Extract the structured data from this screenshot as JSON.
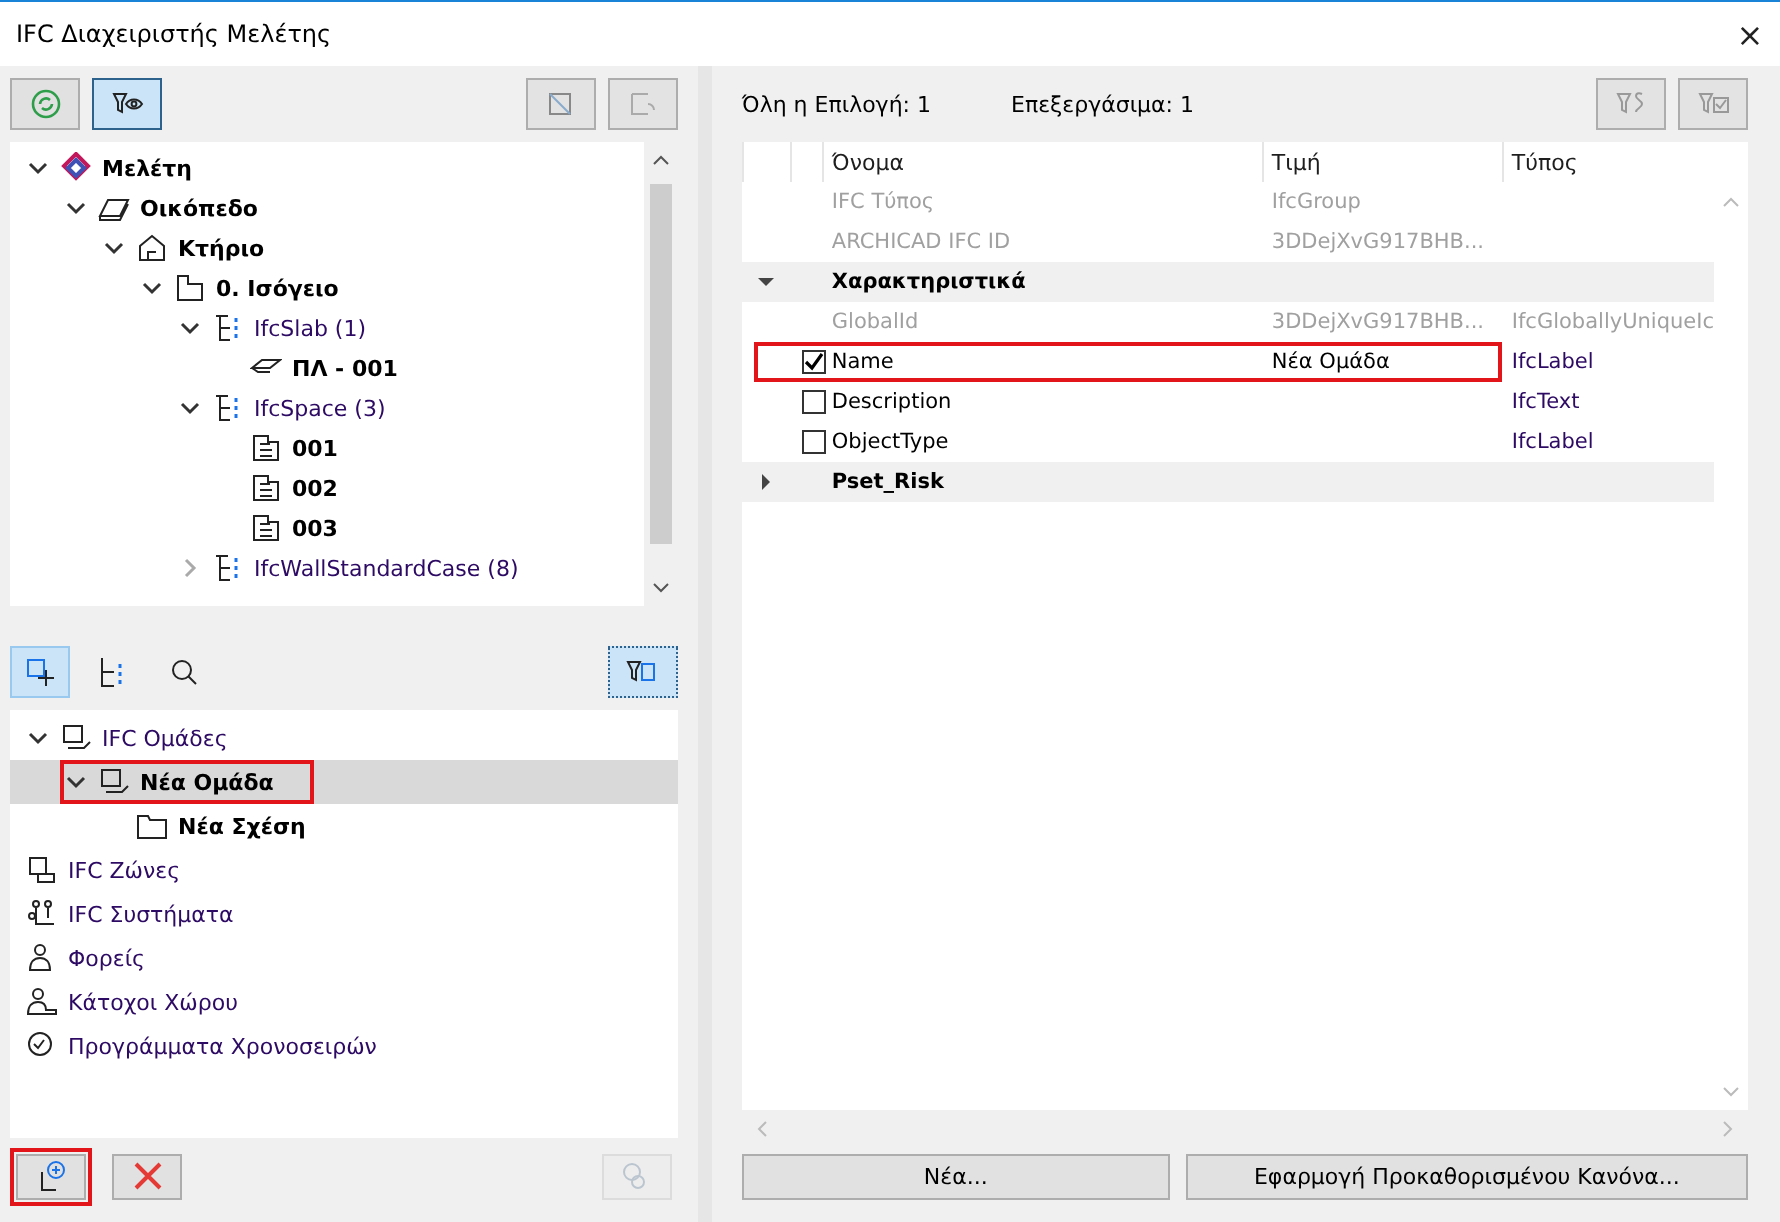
{
  "window": {
    "title": "IFC Διαχειριστής Μελέτης",
    "close": "×"
  },
  "project_toolbar": {
    "filter_view_on": true
  },
  "project_tree": [
    {
      "label": "Μελέτη",
      "kind": "project",
      "bold": true,
      "expanded": true,
      "children": [
        {
          "label": "Οικόπεδο",
          "kind": "site",
          "bold": true,
          "expanded": true,
          "children": [
            {
              "label": "Κτήριο",
              "kind": "building",
              "bold": true,
              "expanded": true,
              "children": [
                {
                  "label": "0. Ισόγειο",
                  "kind": "storey",
                  "bold": true,
                  "expanded": true,
                  "children": [
                    {
                      "label": "IfcSlab (1)",
                      "kind": "class",
                      "bold": false,
                      "expanded": true,
                      "children": [
                        {
                          "label": "ΠΛ - 001",
                          "kind": "slab",
                          "bold": true
                        }
                      ]
                    },
                    {
                      "label": "IfcSpace (3)",
                      "kind": "class",
                      "bold": false,
                      "expanded": true,
                      "children": [
                        {
                          "label": "001",
                          "kind": "space",
                          "bold": true
                        },
                        {
                          "label": "002",
                          "kind": "space",
                          "bold": true
                        },
                        {
                          "label": "003",
                          "kind": "space",
                          "bold": true
                        }
                      ]
                    },
                    {
                      "label": "IfcWallStandardCase (8)",
                      "kind": "class",
                      "bold": false,
                      "expanded": false
                    }
                  ]
                }
              ]
            }
          ]
        }
      ]
    }
  ],
  "group_toolbar": [
    {
      "kind": "groups",
      "selected": true
    },
    {
      "kind": "tree",
      "selected": false
    },
    {
      "kind": "search",
      "selected": false
    }
  ],
  "group_tree": [
    {
      "label": "IFC Ομάδες",
      "kind": "group",
      "bold": false,
      "expanded": true,
      "selected": false,
      "highlighted": false,
      "children": [
        {
          "label": "Νέα Ομάδα",
          "kind": "group",
          "bold": true,
          "expanded": true,
          "selected": true,
          "highlighted": true,
          "children": [
            {
              "label": "Νέα Σχέση",
              "kind": "folder",
              "bold": true,
              "selected": false,
              "highlighted": false
            }
          ]
        }
      ]
    },
    {
      "label": "IFC Ζώνες",
      "kind": "zone",
      "bold": false,
      "selected": false,
      "highlighted": false
    },
    {
      "label": "IFC Συστήματα",
      "kind": "system",
      "bold": false,
      "selected": false,
      "highlighted": false
    },
    {
      "label": "Φορείς",
      "kind": "actor",
      "bold": false,
      "selected": false,
      "highlighted": false
    },
    {
      "label": "Κάτοχοι Χώρου",
      "kind": "occupant",
      "bold": false,
      "selected": false,
      "highlighted": false
    },
    {
      "label": "Προγράμματα Χρονοσειρών",
      "kind": "schedule",
      "bold": false,
      "selected": false,
      "highlighted": false
    }
  ],
  "bottom_buttons": [
    {
      "kind": "add",
      "highlighted": true,
      "disabled": false
    },
    {
      "kind": "delete",
      "highlighted": false,
      "disabled": false
    },
    {
      "kind": "classify",
      "highlighted": false,
      "disabled": true
    }
  ],
  "selection_info": {
    "all": "Όλη η Επιλογή: 1",
    "editable": "Επεξεργάσιμα: 1"
  },
  "properties": {
    "columns": [
      "Όνομα",
      "Τιμή",
      "Τύπος"
    ],
    "rows": [
      {
        "kind": "plain",
        "name": "IFC Τύπος",
        "value": "IfcGroup",
        "type": "",
        "disabled": true
      },
      {
        "kind": "plain",
        "name": "ARCHICAD IFC ID",
        "value": "3DDejXvG917BHB...",
        "type": "",
        "disabled": true
      },
      {
        "kind": "section",
        "name": "Χαρακτηριστικά",
        "expanded": true
      },
      {
        "kind": "plain",
        "name": "GlobalId",
        "value": "3DDejXvG917BHB...",
        "type": "IfcGloballyUniqueIc",
        "disabled": true
      },
      {
        "kind": "check",
        "name": "Name",
        "value": "Νέα Ομάδα",
        "type": "IfcLabel",
        "checked": true,
        "highlighted": true
      },
      {
        "kind": "check",
        "name": "Description",
        "value": "",
        "type": "IfcText",
        "checked": false,
        "highlighted": false
      },
      {
        "kind": "check",
        "name": "ObjectType",
        "value": "",
        "type": "IfcLabel",
        "checked": false,
        "highlighted": false
      },
      {
        "kind": "section",
        "name": "Pset_Risk",
        "expanded": false
      }
    ]
  },
  "actions": [
    "Νέα...",
    "Εφαρμογή Προκαθορισμένου Κανόνα..."
  ]
}
